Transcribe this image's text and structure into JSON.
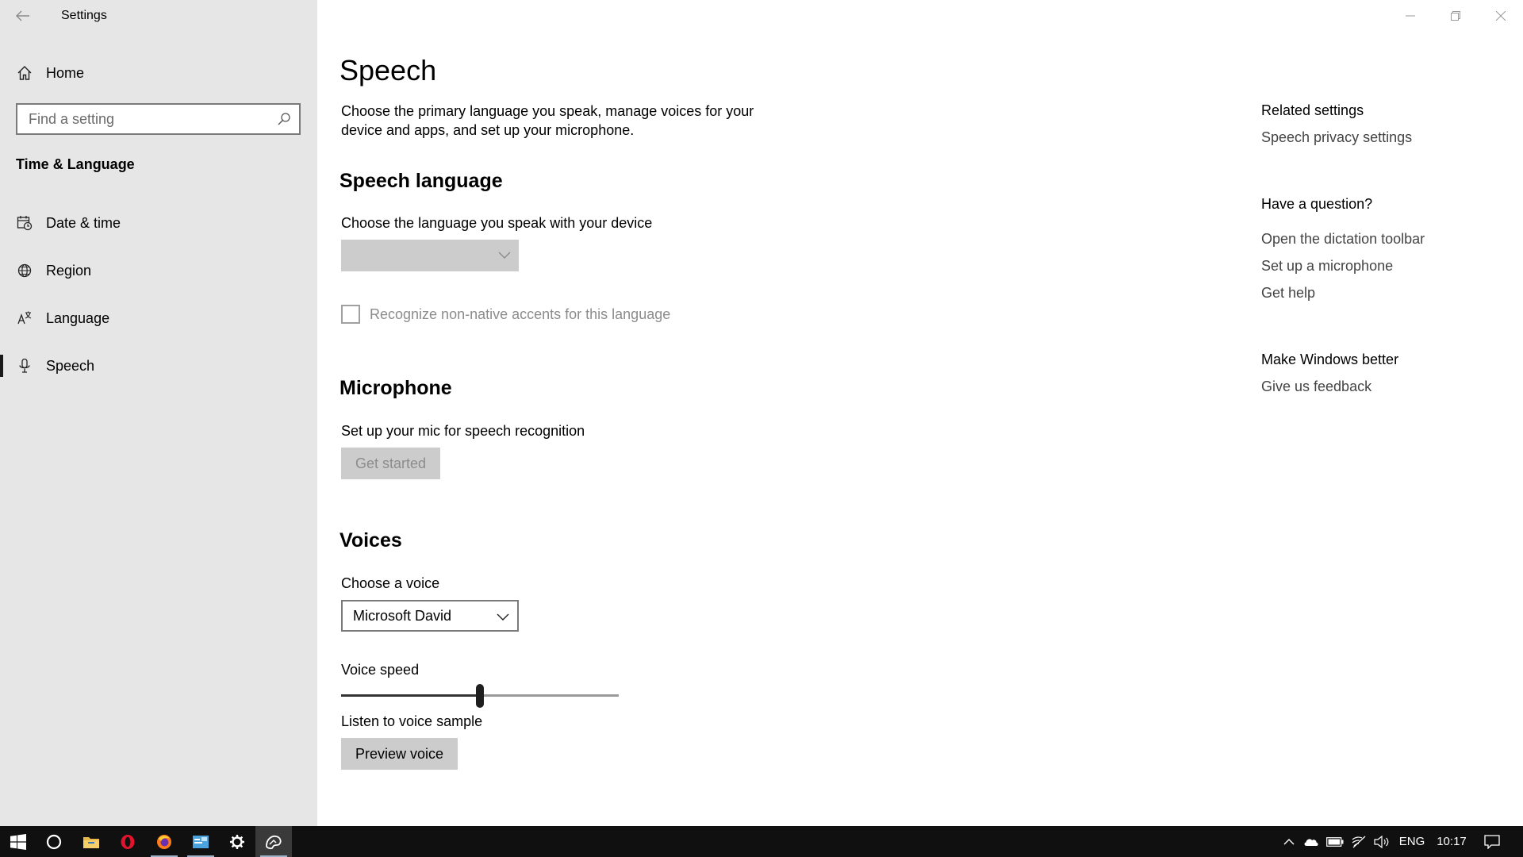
{
  "window": {
    "app_title": "Settings",
    "controls": [
      "minimize",
      "restore",
      "close"
    ]
  },
  "sidebar": {
    "home_label": "Home",
    "search_placeholder": "Find a setting",
    "section_title": "Time & Language",
    "items": [
      {
        "label": "Date & time",
        "icon": "calendar-clock-icon"
      },
      {
        "label": "Region",
        "icon": "globe-icon"
      },
      {
        "label": "Language",
        "icon": "language-icon"
      },
      {
        "label": "Speech",
        "icon": "microphone-icon",
        "active": true
      }
    ]
  },
  "main": {
    "title": "Speech",
    "description": "Choose the primary language you speak, manage voices for your device and apps, and set up your microphone.",
    "speech_language": {
      "heading": "Speech language",
      "label": "Choose the language you speak with your device",
      "selected": "",
      "checkbox_label": "Recognize non-native accents for this language",
      "checkbox_checked": false
    },
    "microphone": {
      "heading": "Microphone",
      "label": "Set up your mic for speech recognition",
      "button": "Get started"
    },
    "voices": {
      "heading": "Voices",
      "choose_label": "Choose a voice",
      "selected_voice": "Microsoft David",
      "speed_label": "Voice speed",
      "speed_value": 0.5,
      "sample_label": "Listen to voice sample",
      "preview_button": "Preview voice"
    }
  },
  "right_panel": {
    "related_heading": "Related settings",
    "related_links": [
      "Speech privacy settings"
    ],
    "question_heading": "Have a question?",
    "question_links": [
      "Open the dictation toolbar",
      "Set up a microphone",
      "Get help"
    ],
    "feedback_heading": "Make Windows better",
    "feedback_links": [
      "Give us feedback"
    ]
  },
  "taskbar": {
    "pinned": [
      "start-icon",
      "cortana-icon",
      "file-explorer-icon",
      "opera-icon",
      "firefox-icon",
      "app-icon",
      "settings-icon",
      "paint-icon"
    ],
    "language": "ENG",
    "time": "10:17"
  },
  "colors": {
    "sidebar_bg": "#e6e6e6",
    "taskbar_bg": "#101010",
    "disabled_control": "#cccccc"
  }
}
